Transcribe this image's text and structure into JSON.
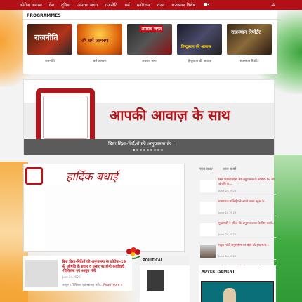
{
  "nav": {
    "items": [
      "कोरोना वायरस",
      "देश",
      "दुनिया",
      "अपराध जगत",
      "राजनीति",
      "धर्म",
      "मनोरंजन",
      "राज्य",
      "राजस्थान विशेष"
    ],
    "video_icon": "video-camera-icon",
    "random_icon": "shuffle-icon"
  },
  "programmes": {
    "heading": "PROGRAMMES",
    "items": [
      {
        "caption": "राजनीति",
        "thumb_text": "राजनीति"
      },
      {
        "caption": "धर्म जागरण",
        "thumb_text": "ॐ धर्म जागरण"
      },
      {
        "caption": "अपराध जगत",
        "thumb_text": "अपराध जगत"
      },
      {
        "caption": "हिन्दुस्तान की आवाज़",
        "thumb_text": "हिन्दुस्तान की आवाज़"
      },
      {
        "caption": "राजस्थान रिपोर्टर",
        "thumb_text": "राजस्थान रिपोर्टर"
      }
    ]
  },
  "banner": {
    "title": "आपकी आवाज़ के साथ",
    "caption": "बिना दिशा-निर्देशों की अनुपालना के...",
    "dots": 9,
    "active_dot": 0
  },
  "greeting": {
    "title": "हार्दिक बधाई"
  },
  "news_tabs": [
    "ताजा खबर",
    "आज खबरें"
  ],
  "news": [
    {
      "title": "बिना दिशा-निर्देशों की अनुपालना के कोरोना-19 की औषधि के...",
      "date": "June 24,2020"
    },
    {
      "title": "प्रयागराज मजिस्ट्रेट ने अपने अपने स्कूल के...",
      "date": "June 24,2020"
    },
    {
      "title": "मुख्यमंत्री ने गठित कि अनुरूप बजट के लिए कार्य...",
      "date": "June 24,2020"
    },
    {
      "title": "राहुल गांधी अनुशासन कर बोले की हाय-बाय...",
      "date": "June 24,2020"
    },
    {
      "title": "जाने की भाजपा रोड़ों को नव ज्यादा की...",
      "date": "June 24,2020"
    }
  ],
  "article": {
    "title": "बिना दिशा-निर्देशों की अनुपालना के कोरोना-19 की औषधि के प्रचार व प्रसार पर होगी कार्यवाही -चिकित्सा एवं आयुष मंत्री",
    "date": "June 24,2020",
    "excerpt": "जयपुर । चिकित्सा एवं स्वास्थ्य मंत्री...",
    "more": "Read more »"
  },
  "political": {
    "heading": "POLITICAL"
  },
  "advertisement": {
    "heading": "ADVERTISEMENT"
  },
  "colors": {
    "brand_red": "#b01016",
    "saffron": "#f7a233",
    "green": "#3aa23a"
  }
}
